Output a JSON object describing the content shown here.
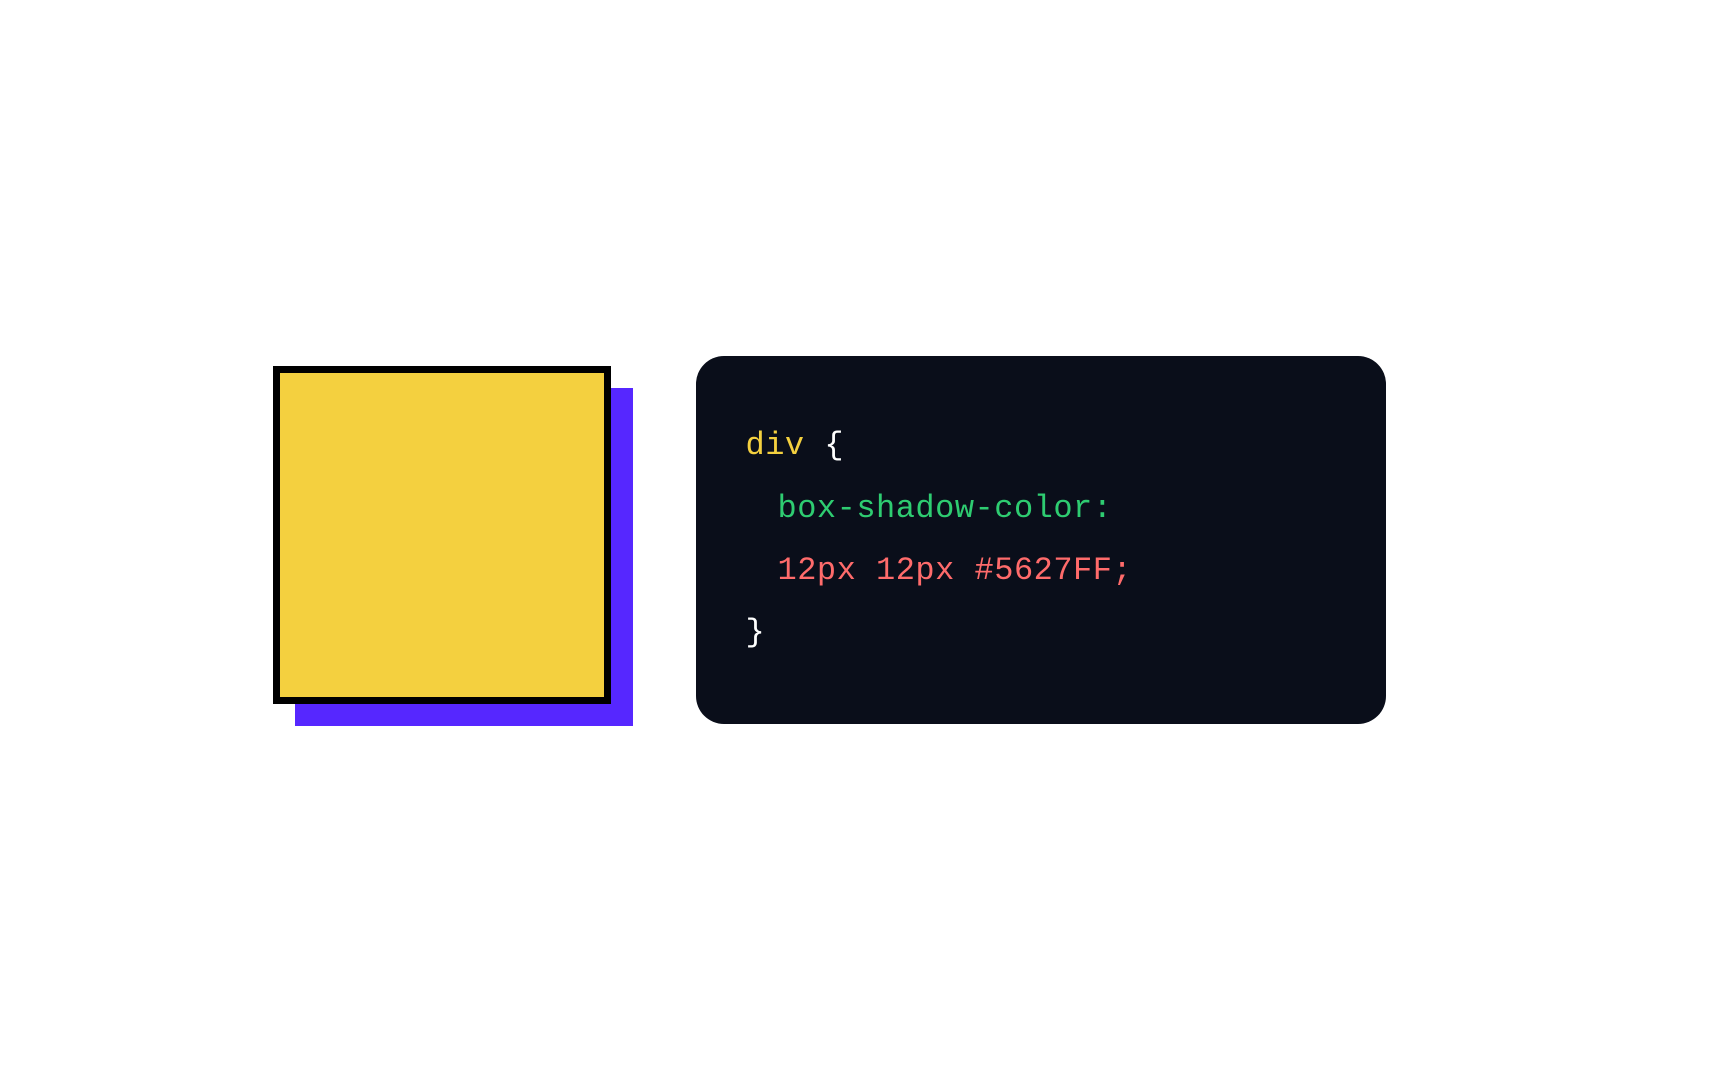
{
  "demo": {
    "box_fill": "#F4D03F",
    "box_border": "#000000",
    "shadow_color": "#5627FF"
  },
  "code": {
    "selector": "div",
    "brace_open": " {",
    "property": "box-shadow-color:",
    "value": "12px 12px #5627FF;",
    "brace_close": "}"
  }
}
